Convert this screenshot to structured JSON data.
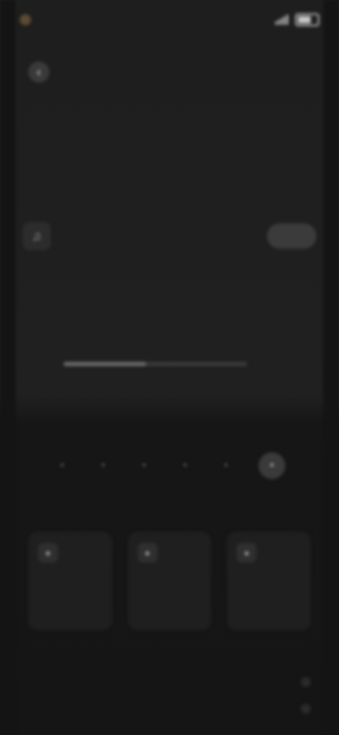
{
  "status_bar": {
    "time": "",
    "icons": [
      "signal-icon",
      "wifi-icon",
      "battery-icon"
    ]
  },
  "header": {
    "back_label": "",
    "title": ""
  },
  "track": {
    "title": "",
    "action_label": ""
  },
  "progress": {
    "fraction": 0.45
  },
  "rating": {
    "count": 6,
    "selected_index": 5
  },
  "section": {
    "label": ""
  },
  "cards": [
    {
      "label": ""
    },
    {
      "label": ""
    },
    {
      "label": ""
    }
  ],
  "bottom": {
    "row1": {
      "left": "",
      "mid": "",
      "right": ""
    },
    "row2": {
      "left": "",
      "mid": "",
      "right": ""
    }
  },
  "colors": {
    "background": "#121212",
    "surface": "#1f1f1f",
    "accent_dot": "#5a4a34"
  }
}
